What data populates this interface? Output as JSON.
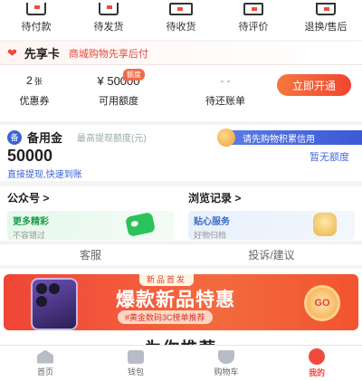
{
  "orders": {
    "items": [
      {
        "label": "待付款",
        "icon": "wallet-icon"
      },
      {
        "label": "待发货",
        "icon": "package-icon"
      },
      {
        "label": "待收货",
        "icon": "truck-icon"
      },
      {
        "label": "待评价",
        "icon": "comment-icon"
      },
      {
        "label": "退换/售后",
        "icon": "return-icon"
      }
    ]
  },
  "xianxiang": {
    "title": "先享卡",
    "subtitle": "商城购物先享后付",
    "coupons_value": "2",
    "coupons_unit": "张",
    "coupons_label": "优惠券",
    "limit_value": "¥ 50000",
    "limit_badge": "额度",
    "limit_label": "可用额度",
    "bill_value": "- -",
    "bill_label": "待还账单",
    "open_button": "立即开通"
  },
  "beiyongjin": {
    "icon_text": "备",
    "title": "备用金",
    "subtitle": "最高提现额度(元)",
    "credit_pill": "请先购物积累信用",
    "amount": "50000",
    "no_limit": "暂无额度",
    "link": "直接提现,快速到账"
  },
  "official_account": {
    "title": "公众号 >",
    "promo_title": "更多精彩",
    "promo_sub": "不容错过"
  },
  "browse_history": {
    "title": "浏览记录 >",
    "promo_title": "贴心服务",
    "promo_sub": "好物归档"
  },
  "service": {
    "customer_service": "客服",
    "complaint": "投诉/建议"
  },
  "banner": {
    "top_tag": "新品首发",
    "title": "爆款新品特惠",
    "sub": "#黄金数码3C榜单推荐",
    "go": "GO"
  },
  "recommend": {
    "title": "为你推荐"
  },
  "tabbar": {
    "items": [
      {
        "label": "首页",
        "icon": "home-icon"
      },
      {
        "label": "钱包",
        "icon": "wallet-tab-icon"
      },
      {
        "label": "购物车",
        "icon": "cart-icon"
      },
      {
        "label": "我的",
        "icon": "profile-icon",
        "active": true
      }
    ]
  },
  "colors": {
    "accent": "#f24a3a",
    "blue": "#3b64d9"
  }
}
